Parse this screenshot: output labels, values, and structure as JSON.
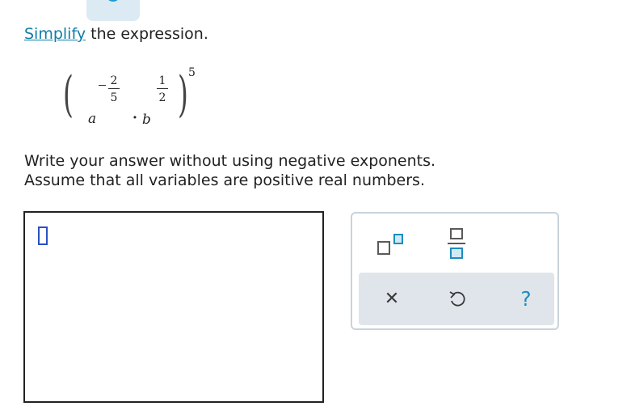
{
  "prompt": {
    "link_text": "Simplify",
    "rest_text": " the expression."
  },
  "expression": {
    "base1": "a",
    "exp1_sign": "−",
    "exp1_num": "2",
    "exp1_den": "5",
    "operator": "·",
    "base2": "b",
    "exp2_num": "1",
    "exp2_den": "2",
    "outer_exp": "5"
  },
  "instructions": {
    "line1": "Write your answer without using negative exponents.",
    "line2": "Assume that all variables are positive real numbers."
  },
  "palette": {
    "tools": [
      "exponent-template-icon",
      "fraction-template-icon"
    ],
    "actions": {
      "clear_glyph": "✕",
      "clear_icon": "close-icon",
      "undo_icon": "undo-icon",
      "help_glyph": "?",
      "help_icon": "help-icon"
    }
  },
  "colors": {
    "link": "#0f7ea8",
    "accent": "#1f8cbd",
    "caret": "#2a4fc2",
    "action_bar": "#dfe5ea"
  }
}
